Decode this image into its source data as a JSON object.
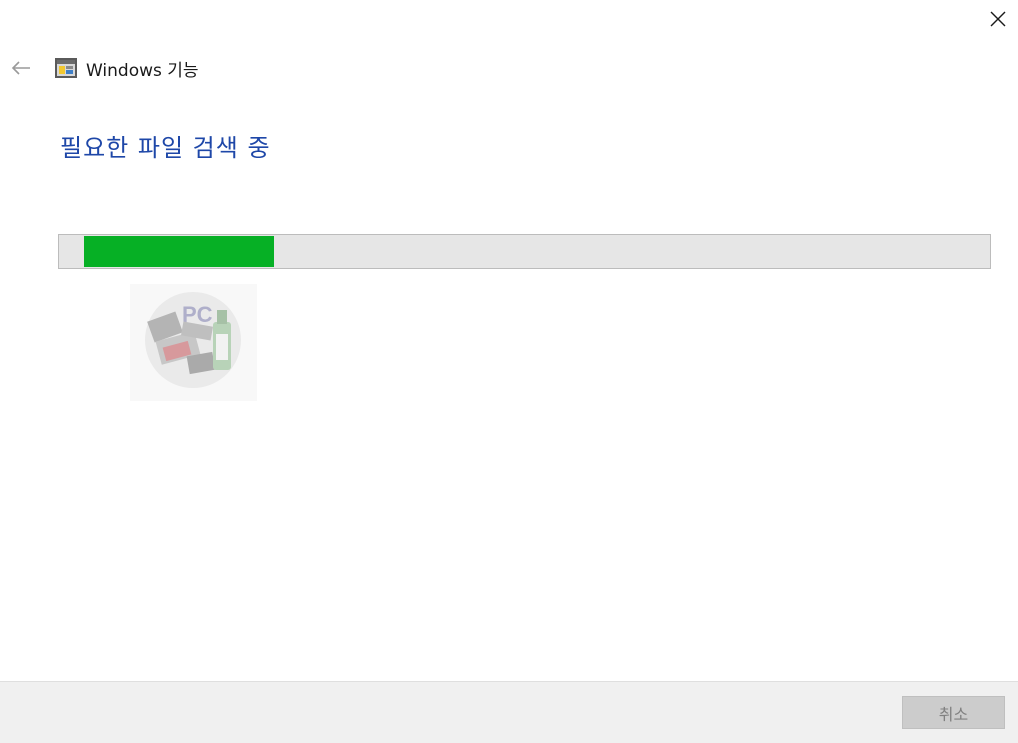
{
  "window": {
    "header_title": "Windows 기능"
  },
  "main": {
    "heading": "필요한 파일 검색 중"
  },
  "progress": {
    "percent": 21.5
  },
  "watermark": {
    "logo_text": "PC"
  },
  "footer": {
    "cancel_label": "취소"
  },
  "icons": {
    "close": "close-icon",
    "back": "back-arrow-icon",
    "app": "windows-features-icon"
  },
  "colors": {
    "heading": "#1e47a8",
    "progress_fill": "#06b025",
    "progress_track": "#e6e6e6",
    "footer_bg": "#f0f0f0",
    "button_disabled_bg": "#cccccc",
    "button_disabled_text": "#808080"
  }
}
